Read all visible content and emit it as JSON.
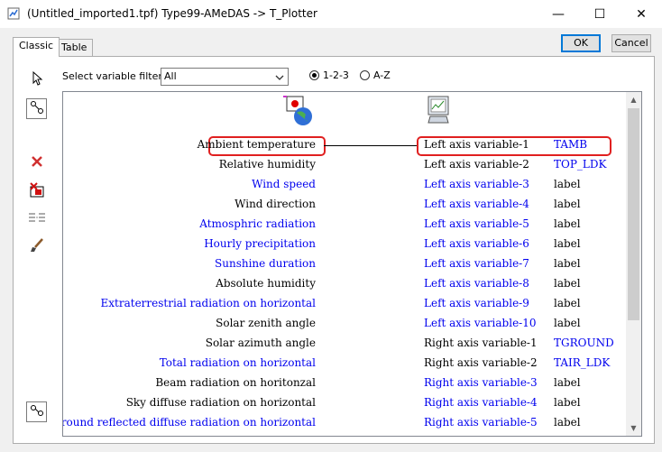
{
  "window": {
    "title": "(Untitled_imported1.tpf) Type99-AMeDAS -> T_Plotter",
    "minimize_glyph": "—",
    "maximize_glyph": "☐",
    "close_glyph": "✕"
  },
  "tabs": [
    {
      "label": "Classic",
      "active": true
    },
    {
      "label": "Table",
      "active": false
    }
  ],
  "buttons": {
    "ok": "OK",
    "cancel": "Cancel"
  },
  "filter": {
    "label": "Select variable filter :",
    "selected": "All",
    "sort_options": [
      {
        "label": "1-2-3",
        "selected": true
      },
      {
        "label": "A-Z",
        "selected": false
      }
    ]
  },
  "toolbar_icons": [
    "pointer-icon",
    "link-icon",
    "delete-icon",
    "delete-link-icon",
    "reorder-icon",
    "brush-icon",
    "chain-icon"
  ],
  "colors": {
    "blue": "#0000ee",
    "highlight": "#e02020"
  },
  "rows": [
    {
      "input": "Ambient temperature",
      "input_color": "black",
      "output": "Left axis variable-1",
      "output_color": "black",
      "label": "TAMB",
      "label_color": "blue",
      "highlighted": true
    },
    {
      "input": "Relative humidity",
      "input_color": "black",
      "output": "Left axis variable-2",
      "output_color": "black",
      "label": "TOP_LDK",
      "label_color": "blue"
    },
    {
      "input": "Wind speed",
      "input_color": "blue",
      "output": "Left axis variable-3",
      "output_color": "blue",
      "label": "label",
      "label_color": "black"
    },
    {
      "input": "Wind direction",
      "input_color": "black",
      "output": "Left axis variable-4",
      "output_color": "blue",
      "label": "label",
      "label_color": "black"
    },
    {
      "input": "Atmosphric radiation",
      "input_color": "blue",
      "output": "Left axis variable-5",
      "output_color": "blue",
      "label": "label",
      "label_color": "black"
    },
    {
      "input": "Hourly precipitation",
      "input_color": "blue",
      "output": "Left axis variable-6",
      "output_color": "blue",
      "label": "label",
      "label_color": "black"
    },
    {
      "input": "Sunshine duration",
      "input_color": "blue",
      "output": "Left axis variable-7",
      "output_color": "blue",
      "label": "label",
      "label_color": "black"
    },
    {
      "input": "Absolute humidity",
      "input_color": "black",
      "output": "Left axis variable-8",
      "output_color": "blue",
      "label": "label",
      "label_color": "black"
    },
    {
      "input": "Extraterrestrial radiation on horizontal",
      "input_color": "blue",
      "output": "Left axis variable-9",
      "output_color": "blue",
      "label": "label",
      "label_color": "black"
    },
    {
      "input": "Solar zenith angle",
      "input_color": "black",
      "output": "Left axis variable-10",
      "output_color": "blue",
      "label": "label",
      "label_color": "black"
    },
    {
      "input": "Solar azimuth angle",
      "input_color": "black",
      "output": "Right axis variable-1",
      "output_color": "black",
      "label": "TGROUND",
      "label_color": "blue"
    },
    {
      "input": "Total radiation on horizontal",
      "input_color": "blue",
      "output": "Right axis variable-2",
      "output_color": "black",
      "label": "TAIR_LDK",
      "label_color": "blue"
    },
    {
      "input": "Beam radiation on horitonzal",
      "input_color": "black",
      "output": "Right axis variable-3",
      "output_color": "blue",
      "label": "label",
      "label_color": "black"
    },
    {
      "input": "Sky diffuse radiation on horizontal",
      "input_color": "black",
      "output": "Right axis variable-4",
      "output_color": "blue",
      "label": "label",
      "label_color": "black"
    },
    {
      "input": "Ground reflected diffuse radiation on horizontal",
      "input_color": "blue",
      "output": "Right axis variable-5",
      "output_color": "blue",
      "label": "label",
      "label_color": "black"
    }
  ]
}
